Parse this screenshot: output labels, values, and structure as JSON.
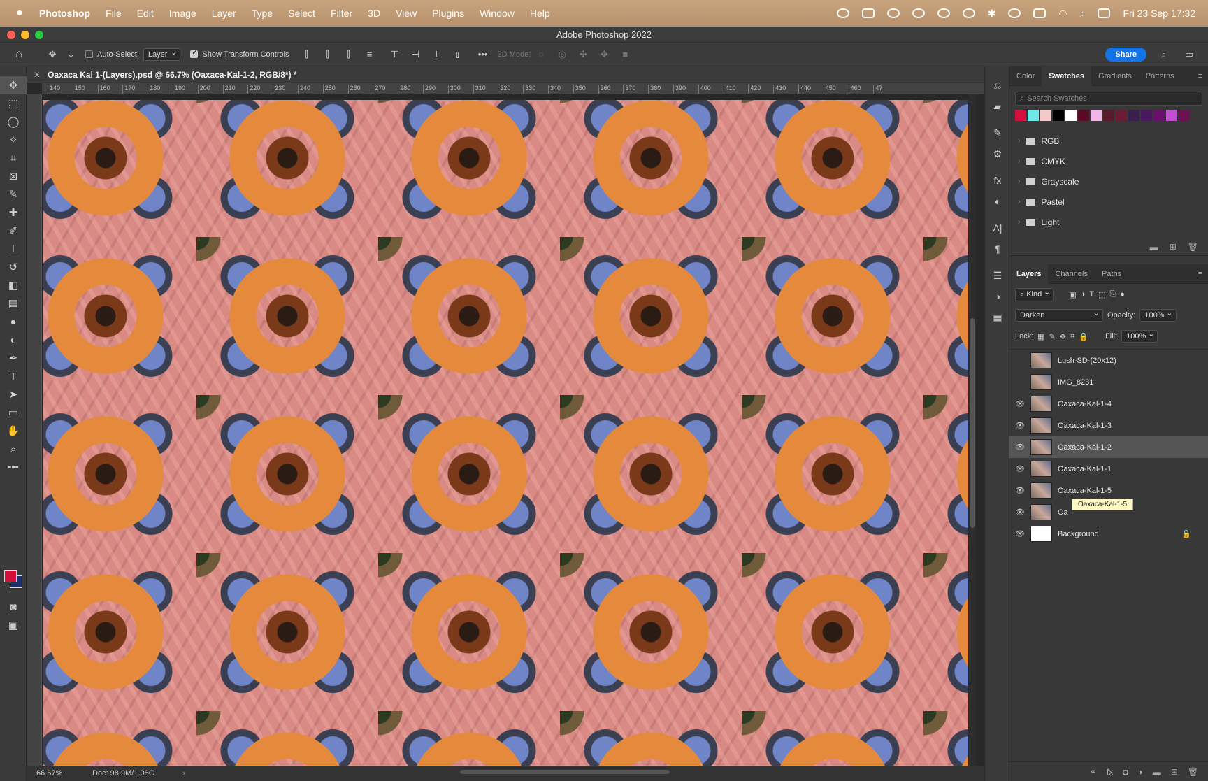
{
  "menubar": {
    "app": "Photoshop",
    "items": [
      "File",
      "Edit",
      "Image",
      "Layer",
      "Type",
      "Select",
      "Filter",
      "3D",
      "View",
      "Plugins",
      "Window",
      "Help"
    ],
    "clock": "Fri 23 Sep  17:32"
  },
  "window_title": "Adobe Photoshop 2022",
  "options": {
    "auto_select": "Auto-Select:",
    "auto_select_target": "Layer",
    "show_transform": "Show Transform Controls",
    "mode_3d": "3D Mode:",
    "share": "Share"
  },
  "document": {
    "tab_title": "Oaxaca Kal 1-(Layers).psd @ 66.7% (Oaxaca-Kal-1-2, RGB/8*) *",
    "zoom": "66.67%",
    "doc_size": "Doc: 98.9M/1.08G",
    "ruler_ticks": [
      "140",
      "150",
      "160",
      "170",
      "180",
      "190",
      "200",
      "210",
      "220",
      "230",
      "240",
      "250",
      "260",
      "270",
      "280",
      "290",
      "300",
      "310",
      "320",
      "330",
      "340",
      "350",
      "360",
      "370",
      "380",
      "390",
      "400",
      "410",
      "420",
      "430",
      "440",
      "450",
      "460",
      "47"
    ]
  },
  "swatches_panel": {
    "tabs": [
      "Color",
      "Swatches",
      "Gradients",
      "Patterns"
    ],
    "active_tab": "Swatches",
    "search_placeholder": "Search Swatches",
    "colors": [
      "#d6103e",
      "#6ee8e8",
      "#f4c9c9",
      "#000000",
      "#ffffff",
      "#5a0a22",
      "#f0b4e6",
      "#5b1a2a",
      "#6e1a32",
      "#3a1e4e",
      "#4a1860",
      "#6a0f6e",
      "#c24fcf",
      "#6b1252"
    ],
    "folders": [
      "RGB",
      "CMYK",
      "Grayscale",
      "Pastel",
      "Light"
    ]
  },
  "layers_panel": {
    "tabs": [
      "Layers",
      "Channels",
      "Paths"
    ],
    "active_tab": "Layers",
    "filter": "Kind",
    "blend_mode": "Darken",
    "opacity_label": "Opacity:",
    "opacity": "100%",
    "lock_label": "Lock:",
    "fill_label": "Fill:",
    "fill": "100%",
    "layers": [
      {
        "name": "Lush-SD-(20x12)",
        "visible": false
      },
      {
        "name": "IMG_8231",
        "visible": false
      },
      {
        "name": "Oaxaca-Kal-1-4",
        "visible": true
      },
      {
        "name": "Oaxaca-Kal-1-3",
        "visible": true
      },
      {
        "name": "Oaxaca-Kal-1-2",
        "visible": true,
        "selected": true
      },
      {
        "name": "Oaxaca-Kal-1-1",
        "visible": true
      },
      {
        "name": "Oaxaca-Kal-1-5",
        "visible": true
      },
      {
        "name": "Oa",
        "visible": true
      },
      {
        "name": "Background",
        "visible": true,
        "locked": true
      }
    ],
    "tooltip": "Oaxaca-Kal-1-5"
  },
  "colors": {
    "foreground": "#d0103a",
    "background": "#1f2c6b",
    "accent": "#1473e6"
  }
}
